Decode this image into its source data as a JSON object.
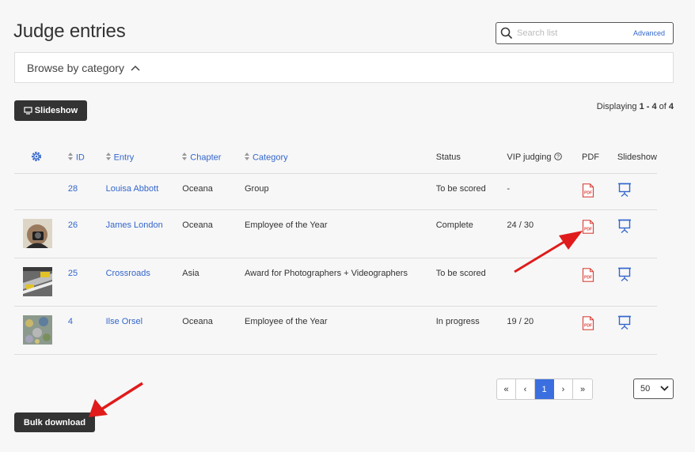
{
  "title": "Judge entries",
  "search": {
    "placeholder": "Search list",
    "advanced_label": "Advanced"
  },
  "browse": {
    "label": "Browse by category"
  },
  "toolbar": {
    "slideshow_label": "Slideshow"
  },
  "display": {
    "prefix": "Displaying ",
    "range": "1 - 4",
    "of": " of ",
    "total": "4"
  },
  "table": {
    "headers": {
      "id": "ID",
      "entry": "Entry",
      "chapter": "Chapter",
      "category": "Category",
      "status": "Status",
      "vip": "VIP judging",
      "pdf": "PDF",
      "slideshow": "Slideshow"
    },
    "rows": [
      {
        "id": "28",
        "entry": "Louisa Abbott",
        "chapter": "Oceana",
        "category": "Group",
        "status": "To be scored",
        "vip": "-",
        "has_thumb": false
      },
      {
        "id": "26",
        "entry": "James London",
        "chapter": "Oceana",
        "category": "Employee of the Year",
        "status": "Complete",
        "vip": "24 / 30",
        "has_thumb": true
      },
      {
        "id": "25",
        "entry": "Crossroads",
        "chapter": "Asia",
        "category": "Award for Photographers + Videographers",
        "status": "To be scored",
        "vip": "",
        "has_thumb": true
      },
      {
        "id": "4",
        "entry": "Ilse Orsel",
        "chapter": "Oceana",
        "category": "Employee of the Year",
        "status": "In progress",
        "vip": "19 / 20",
        "has_thumb": true
      }
    ]
  },
  "pagination": {
    "first": "«",
    "prev": "‹",
    "current": "1",
    "next": "›",
    "last": "»"
  },
  "per_page": {
    "value": "50"
  },
  "bulk": {
    "label": "Bulk download"
  },
  "colors": {
    "link": "#3366cc",
    "pdf": "#d9473f",
    "arrow": "#e01b1b",
    "dark_button": "#333333",
    "active_page": "#3b6fe0"
  },
  "icons": [
    "search-icon",
    "chevron-up-icon",
    "monitor-icon",
    "gear-icon",
    "sort-icon",
    "info-icon",
    "pdf-icon",
    "presentation-icon",
    "chevron-down-icon"
  ]
}
